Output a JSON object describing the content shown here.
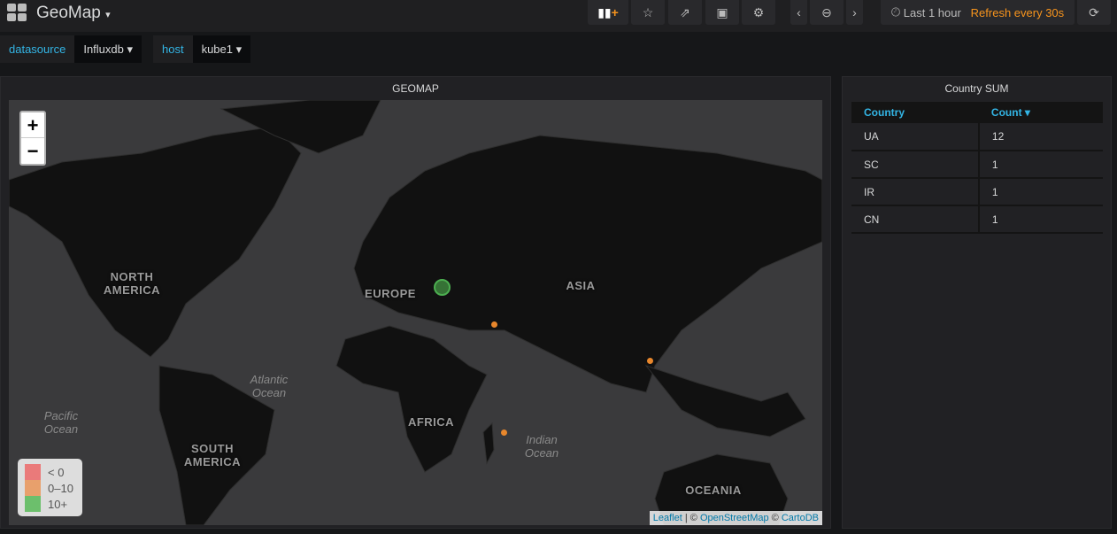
{
  "header": {
    "title": "GeoMap",
    "time_range": "Last 1 hour",
    "refresh": "Refresh every 30s"
  },
  "variables": [
    {
      "label": "datasource",
      "value": "Influxdb"
    },
    {
      "label": "host",
      "value": "kube1"
    }
  ],
  "geomap": {
    "title": "GEOMAP",
    "zoom_in": "+",
    "zoom_out": "−",
    "labels": {
      "north_america": "NORTH AMERICA",
      "europe": "EUROPE",
      "asia": "ASIA",
      "africa": "AFRICA",
      "south_america": "SOUTH AMERICA",
      "oceania": "OCEANIA",
      "atlantic": "Atlantic Ocean",
      "pacific": "Pacific Ocean",
      "indian": "Indian Ocean"
    },
    "legend": [
      {
        "label": "< 0",
        "color": "#ea7a7a"
      },
      {
        "label": "0–10",
        "color": "#e8a06c"
      },
      {
        "label": "10+",
        "color": "#6cbf6c"
      }
    ],
    "attribution": {
      "leaflet": "Leaflet",
      "sep": " | © ",
      "osm": "OpenStreetMap",
      "sep2": " © ",
      "carto": "CartoDB"
    }
  },
  "country_sum": {
    "title": "Country SUM",
    "columns": [
      "Country",
      "Count"
    ],
    "rows": [
      [
        "UA",
        "12"
      ],
      [
        "SC",
        "1"
      ],
      [
        "IR",
        "1"
      ],
      [
        "CN",
        "1"
      ]
    ]
  }
}
